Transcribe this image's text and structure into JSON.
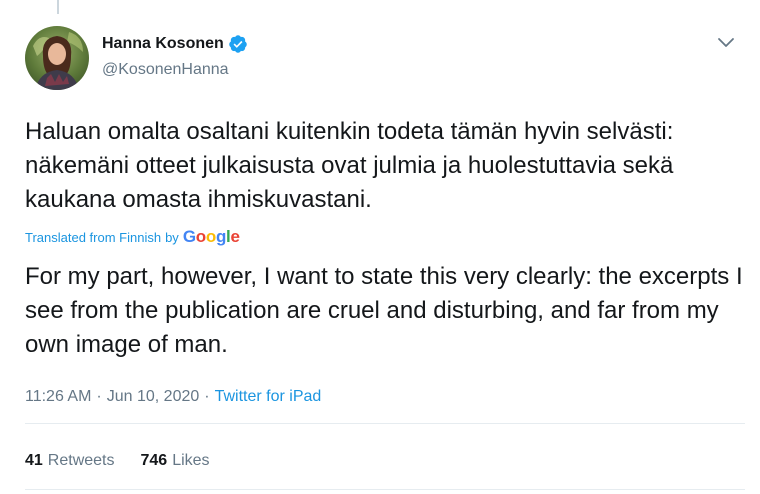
{
  "author": {
    "name": "Hanna Kosonen",
    "handle": "@KosonenHanna",
    "verified": true
  },
  "tweet": {
    "text": "Haluan omalta osaltani kuitenkin todeta tämän hyvin selvästi: näkemäni otteet julkaisusta ovat julmia ja huolestuttavia sekä kaukana omasta ihmiskuvastani.",
    "translated_label": "Translated from Finnish",
    "translated_by": "by",
    "translation_provider": "Google",
    "translation": "For my part, however, I want to state this very clearly: the excerpts I see from the publication are cruel and disturbing, and far from my own image of man.",
    "time": "11:26 AM",
    "separator": "·",
    "date": "Jun 10, 2020",
    "source": "Twitter for iPad"
  },
  "stats": {
    "retweets_count": "41",
    "retweets_label": "Retweets",
    "likes_count": "746",
    "likes_label": "Likes"
  },
  "colors": {
    "link": "#1b95e0",
    "verified": "#1da1f2",
    "secondary_text": "#657786"
  },
  "icons": {
    "verified": "verified-badge-icon",
    "caret": "chevron-down-icon"
  }
}
